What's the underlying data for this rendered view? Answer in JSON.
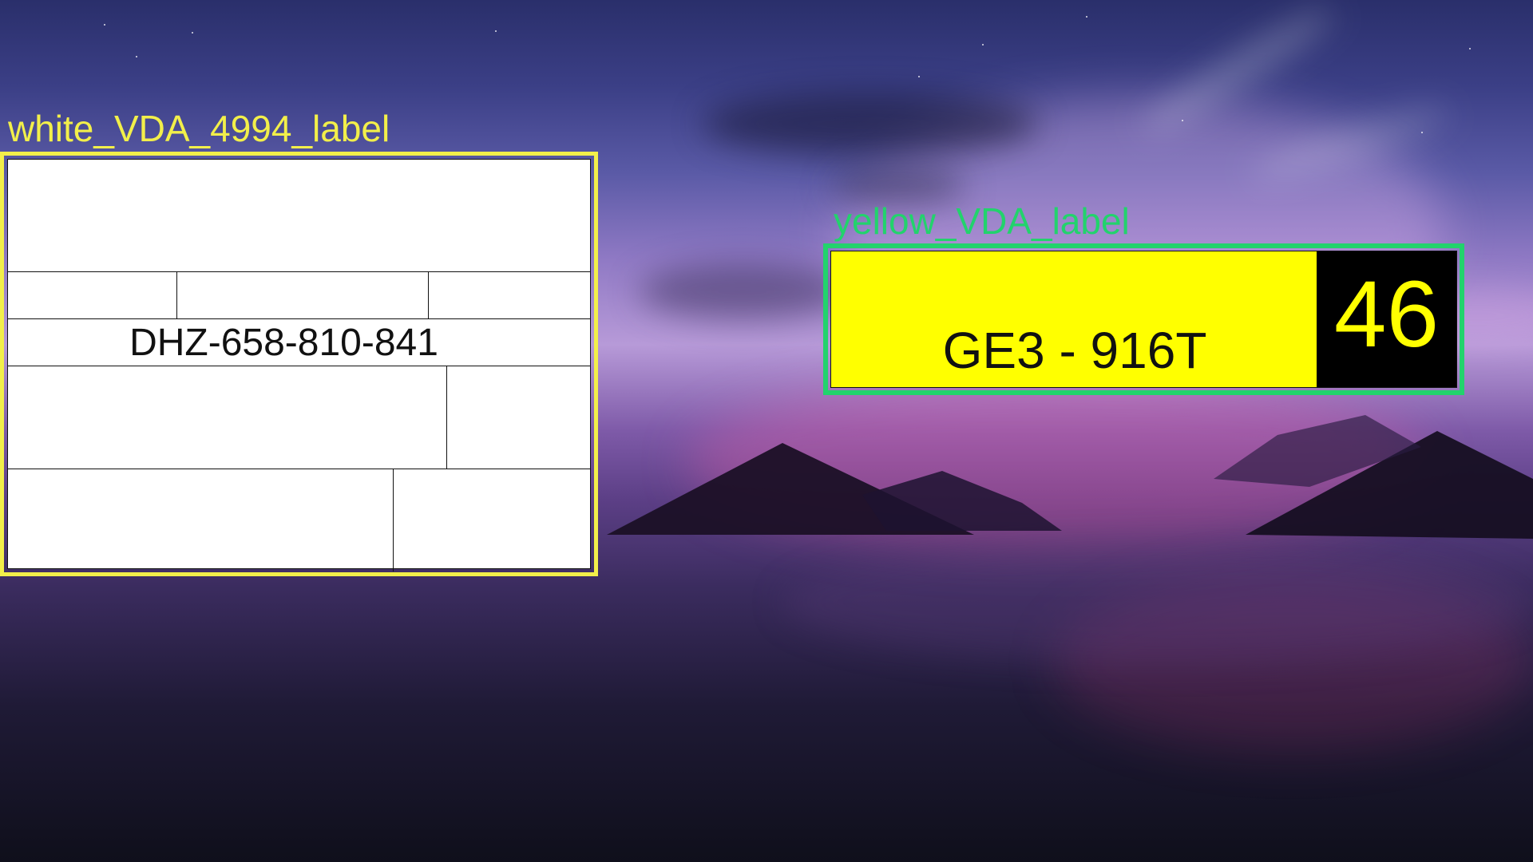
{
  "labels": {
    "white": {
      "caption": "white_VDA_4994_label",
      "code": "DHZ-658-810-841"
    },
    "yellow": {
      "caption": "yellow_VDA_label",
      "code": "GE3 - 916T",
      "number": "46"
    }
  },
  "colors": {
    "white_box": "#f2ef4a",
    "yellow_box": "#22d36c",
    "yellow_label": "#ffff00",
    "yellow_number_panel": "#000000"
  }
}
